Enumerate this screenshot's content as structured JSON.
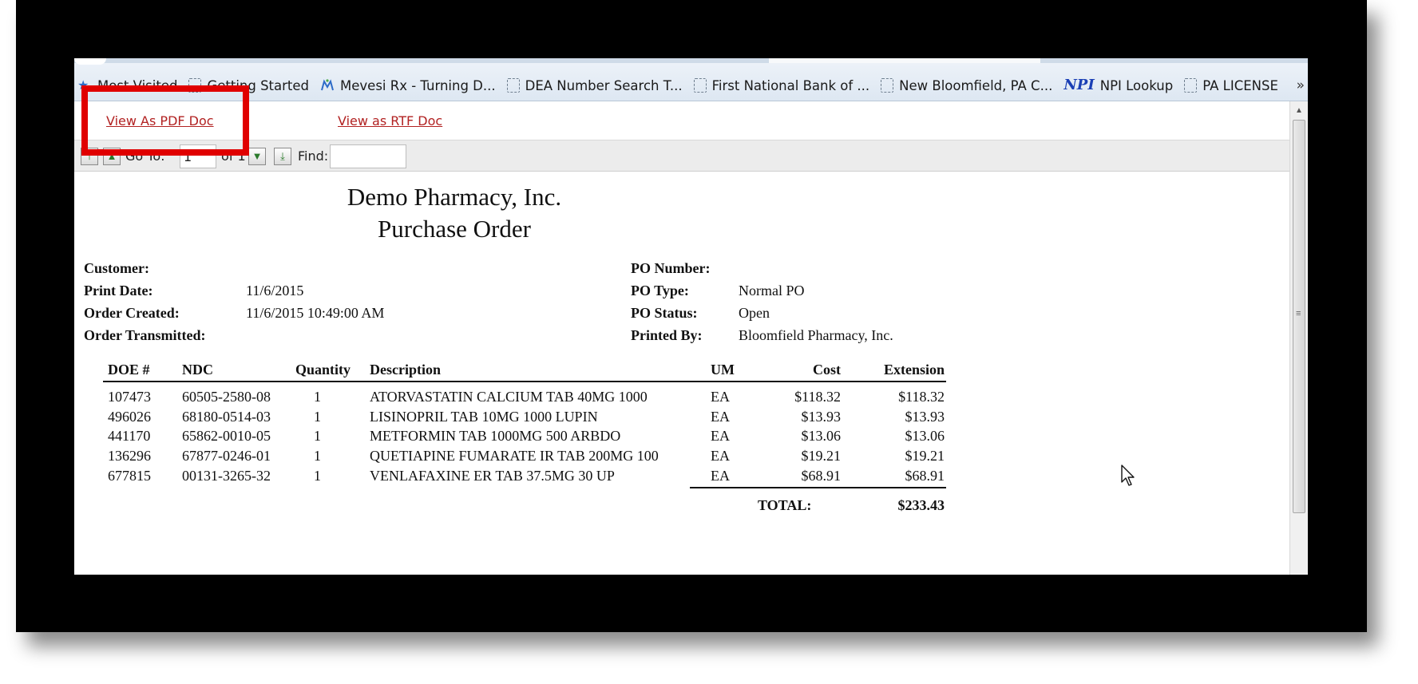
{
  "bookmarks": {
    "items": [
      {
        "label": "Most Visited",
        "icon": "star-icon"
      },
      {
        "label": "Getting Started",
        "icon": "page-icon"
      },
      {
        "label": "Mevesi Rx - Turning D...",
        "icon": "mevesi-icon"
      },
      {
        "label": "DEA Number Search T...",
        "icon": "page-icon"
      },
      {
        "label": "First National Bank of ...",
        "icon": "page-icon"
      },
      {
        "label": "New Bloomfield, PA C...",
        "icon": "page-icon"
      },
      {
        "label": "NPI Lookup",
        "icon": "npi-icon"
      },
      {
        "label": "PA LICENSE",
        "icon": "page-icon"
      }
    ],
    "more": "»",
    "npi_icon_text": "NPI"
  },
  "toolbar": {
    "pdf_link": "View As PDF Doc",
    "rtf_link": "View as RTF Doc",
    "goto_label": "Go To:",
    "goto_value": "1",
    "of_label": "of 1",
    "find_label": "Find:",
    "find_value": ""
  },
  "report": {
    "company": "Demo Pharmacy, Inc.",
    "title": "Purchase Order",
    "left_fields": [
      {
        "label": "Customer:",
        "value": ""
      },
      {
        "label": "Print Date:",
        "value": "11/6/2015"
      },
      {
        "label": "Order Created:",
        "value": "11/6/2015 10:49:00 AM"
      },
      {
        "label": "Order Transmitted:",
        "value": ""
      }
    ],
    "right_fields": [
      {
        "label": "PO Number:",
        "value": ""
      },
      {
        "label": "PO Type:",
        "value": "Normal PO"
      },
      {
        "label": "PO Status:",
        "value": "Open"
      },
      {
        "label": "Printed By:",
        "value": "Bloomfield Pharmacy, Inc."
      }
    ],
    "columns": [
      "DOE #",
      "NDC",
      "Quantity",
      "Description",
      "UM",
      "Cost",
      "Extension"
    ],
    "rows": [
      {
        "doe": "107473",
        "ndc": "60505-2580-08",
        "qty": "1",
        "desc": "ATORVASTATIN CALCIUM TAB 40MG 1000",
        "um": "EA",
        "cost": "$118.32",
        "ext": "$118.32"
      },
      {
        "doe": "496026",
        "ndc": "68180-0514-03",
        "qty": "1",
        "desc": "LISINOPRIL TAB 10MG 1000 LUPIN",
        "um": "EA",
        "cost": "$13.93",
        "ext": "$13.93"
      },
      {
        "doe": "441170",
        "ndc": "65862-0010-05",
        "qty": "1",
        "desc": "METFORMIN TAB 1000MG 500 ARBDO",
        "um": "EA",
        "cost": "$13.06",
        "ext": "$13.06"
      },
      {
        "doe": "136296",
        "ndc": "67877-0246-01",
        "qty": "1",
        "desc": "QUETIAPINE FUMARATE IR TAB 200MG 100",
        "um": "EA",
        "cost": "$19.21",
        "ext": "$19.21"
      },
      {
        "doe": "677815",
        "ndc": "00131-3265-32",
        "qty": "1",
        "desc": "VENLAFAXINE ER TAB 37.5MG 30 UP",
        "um": "EA",
        "cost": "$68.91",
        "ext": "$68.91"
      }
    ],
    "total_label": "TOTAL:",
    "total_value": "$233.43"
  },
  "colors": {
    "link": "#b22222",
    "highlight": "#e00000",
    "frame": "#000000"
  }
}
